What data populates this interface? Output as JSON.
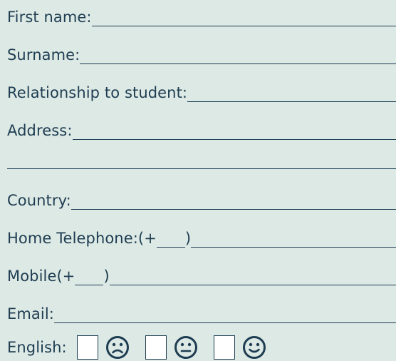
{
  "form": {
    "first_name_label": "First name:",
    "surname_label": "Surname:",
    "relationship_label": "Relationship to student:",
    "address_label": "Address:",
    "country_label": "Country:",
    "home_phone_label_pre": "Home Telephone:(+",
    "home_phone_label_post": ")",
    "mobile_label_pre": "Mobile(+",
    "mobile_label_post": ")",
    "email_label": "Email:",
    "english_label": "English:"
  },
  "english_options": [
    {
      "icon": "sad-face-icon"
    },
    {
      "icon": "neutral-face-icon"
    },
    {
      "icon": "smiley-face-icon"
    }
  ],
  "colors": {
    "background": "#dde9e4",
    "text": "#1e3d52",
    "checkbox_fill": "#ffffff"
  }
}
